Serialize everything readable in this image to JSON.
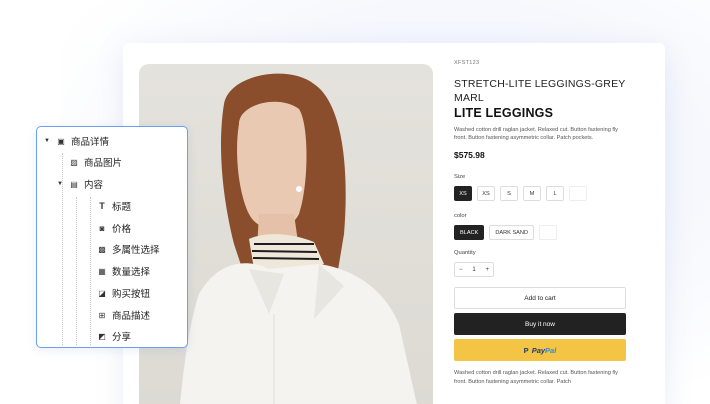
{
  "product": {
    "sku": "XFST123",
    "title_line1": "STRETCH-LITE LEGGINGS-GREY",
    "title_line2": "MARL",
    "title_bold": "LITE LEGGINGS",
    "short_desc": "Washed cotton drill raglan jacket. Relaxed cut. Button fastening fly front. Button fastening asymmetric collar. Patch pockets.",
    "price": "$575.98",
    "size_label": "Size",
    "sizes": [
      "XS",
      "XS",
      "S",
      "M",
      "L",
      ""
    ],
    "selected_size_index": 0,
    "color_label": "color",
    "colors": [
      "BLACK",
      "DARK SAND",
      ""
    ],
    "selected_color_index": 0,
    "quantity_label": "Quantity",
    "quantity": "1",
    "qty_minus": "−",
    "qty_plus": "+",
    "add_to_cart": "Add to cart",
    "buy_now": "Buy it now",
    "paypal_pay": "Pay",
    "paypal_pal": "Pal",
    "long_desc": "Washed cotton drill raglan jacket. Relaxed cut. Button fastening fly front. Button fastening asymmetric collar. Patch"
  },
  "tree": {
    "items": [
      {
        "label": "商品详情",
        "icon": "gallery-icon",
        "glyph": "▣",
        "level": 0,
        "expanded": true
      },
      {
        "label": "商品图片",
        "icon": "image-icon",
        "glyph": "▨",
        "level": 1
      },
      {
        "label": "内容",
        "icon": "content-icon",
        "glyph": "▤",
        "level": 1,
        "expanded": true
      },
      {
        "label": "标题",
        "icon": "text-icon",
        "glyph": "T",
        "level": 2
      },
      {
        "label": "价格",
        "icon": "price-icon",
        "glyph": "◙",
        "level": 2
      },
      {
        "label": "多属性选择",
        "icon": "sku-icon",
        "glyph": "▩",
        "level": 2
      },
      {
        "label": "数量选择",
        "icon": "number-icon",
        "glyph": "▦",
        "level": 2
      },
      {
        "label": "购买按钮",
        "icon": "buy-button-icon",
        "glyph": "◪",
        "level": 2
      },
      {
        "label": "商品描述",
        "icon": "description-icon",
        "glyph": "⊞",
        "level": 2
      },
      {
        "label": "分享",
        "icon": "share-icon",
        "glyph": "◩",
        "level": 2
      }
    ]
  }
}
